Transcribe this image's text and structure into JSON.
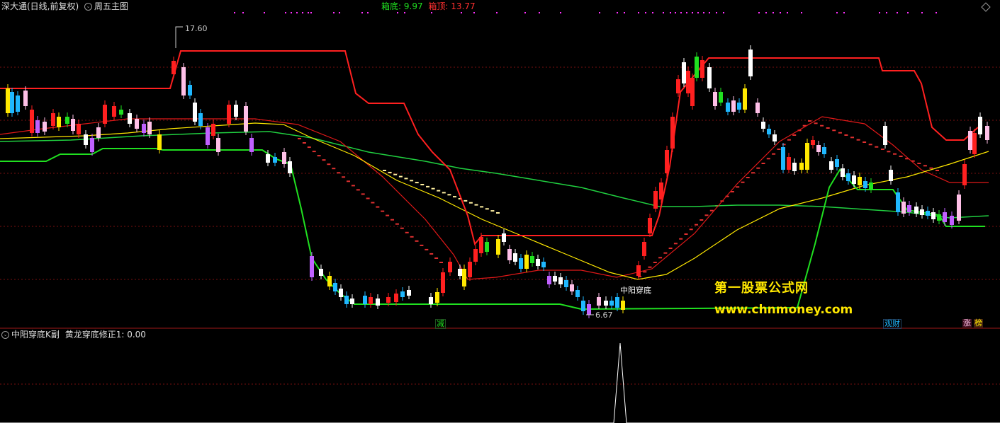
{
  "header": {
    "title": "深大通(日线,前复权)",
    "indicator": "周五主图",
    "box_bottom_label": "箱底:",
    "box_bottom_value": "9.97",
    "box_top_label": "箱顶:",
    "box_top_value": "13.77"
  },
  "main_chart": {
    "high_label": "17.60",
    "low_label": "6.67",
    "signal_label": "中阳穿底",
    "watermark_cn": "第一股票公式网",
    "watermark_url": "www.chnmoney.com",
    "tag_jian": "减",
    "tag_guancai": "观财",
    "tag_zhang": "涨",
    "tag_bang": "榜"
  },
  "sub_chart": {
    "title": "中阳穿底K副",
    "indicator_label": "黄龙穿底修正1:",
    "indicator_value": "0.00"
  },
  "colors": {
    "red": "#ff2020",
    "green": "#20e020",
    "yellow": "#ffe800",
    "cyan": "#1fb8ff",
    "magenta": "#ff30ff",
    "pink": "#ffc0e8",
    "purple": "#c060ff"
  }
}
